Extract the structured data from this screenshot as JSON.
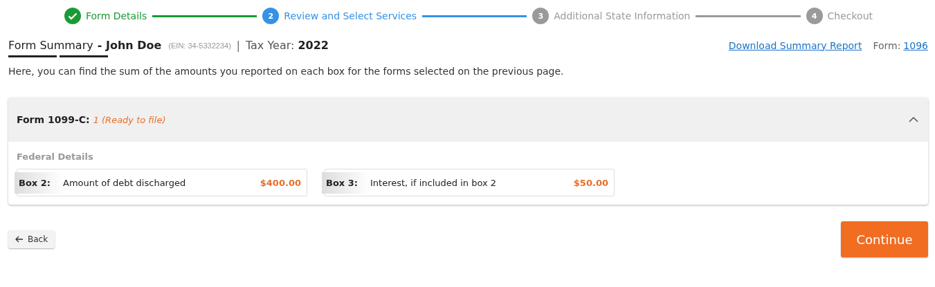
{
  "steps": [
    {
      "label": "Form Details",
      "kind": "done"
    },
    {
      "number": "2",
      "label": "Review and Select Services",
      "kind": "current"
    },
    {
      "number": "3",
      "label": "Additional State Information",
      "kind": "pending"
    },
    {
      "number": "4",
      "label": "Checkout",
      "kind": "pending"
    }
  ],
  "header": {
    "title": "Form Summary",
    "name": "- John Doe",
    "ein": "(EIN: 34-5332234)",
    "separator": "|",
    "tax_year_label": "Tax Year:",
    "tax_year": "2022",
    "download_link": "Download Summary Report",
    "form_label": "Form:",
    "form_link": "1096"
  },
  "intro": "Here, you can find the sum of the amounts you reported on each box for the forms selected on the previous page.",
  "card": {
    "title": "Form 1099-C:",
    "status": "1 (Ready to file)",
    "expanded": true,
    "section": "Federal Details",
    "boxes": [
      {
        "label": "Box 2:",
        "description": "Amount of debt discharged",
        "amount": "$400.00"
      },
      {
        "label": "Box 3:",
        "description": "Interest, if included in box 2",
        "amount": "$50.00"
      }
    ]
  },
  "back_button": "Back",
  "continue_button": "Continue"
}
